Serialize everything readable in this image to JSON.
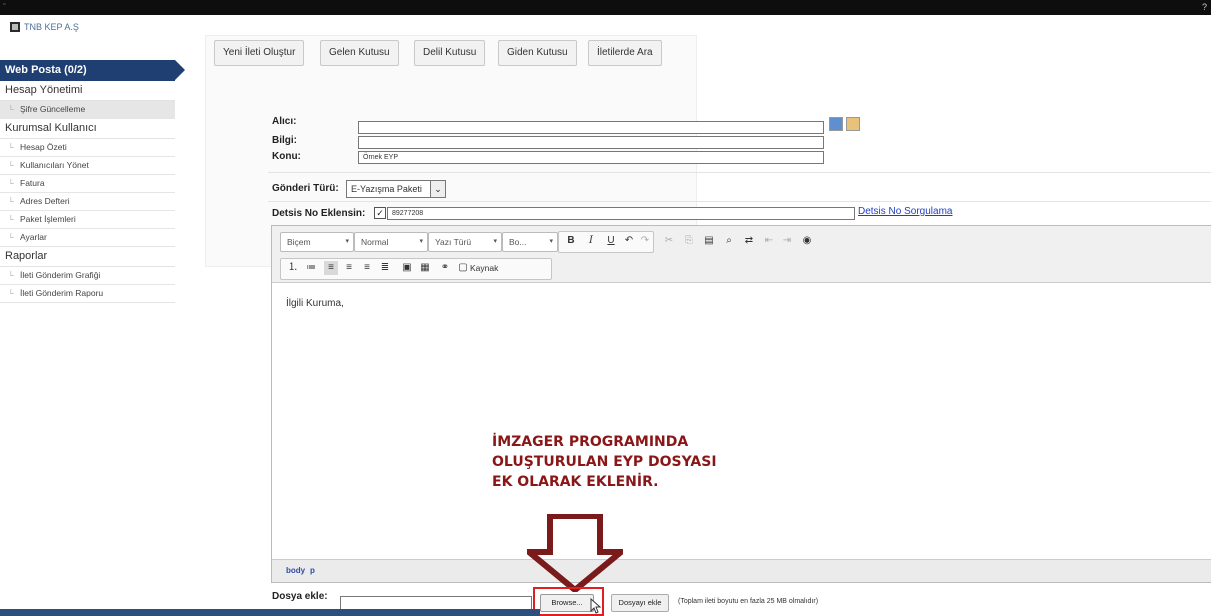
{
  "app": {
    "logo_text": "TNB KEP A.Ş",
    "corner_mark": "?"
  },
  "sidebar": {
    "active_label": "Web Posta (0/2)",
    "sections": [
      {
        "label": "Hesap Yönetimi",
        "items": [
          "Şifre Güncelleme"
        ]
      },
      {
        "label": "Kurumsal Kullanıcı",
        "items": [
          "Hesap Özeti",
          "Kullanıcıları Yönet",
          "Fatura",
          "Adres Defteri",
          "Paket İşlemleri",
          "Ayarlar"
        ]
      },
      {
        "label": "Raporlar",
        "items": [
          "İleti Gönderim Grafiği",
          "İleti Gönderim Raporu"
        ]
      }
    ]
  },
  "toolbar": {
    "buttons": [
      "Yeni İleti Oluştur",
      "Gelen Kutusu",
      "Delil Kutusu",
      "Giden Kutusu",
      "İletilerde Ara"
    ]
  },
  "form": {
    "to_label": "Alıcı:",
    "cc_label": "Bilgi:",
    "subject_label": "Konu:",
    "subject_value": "Örnek EYP",
    "send_type_label": "Gönderi Türü:",
    "send_type_value": "E-Yazışma Paketi",
    "detsis_label": "Detsis No Eklensin:",
    "detsis_value": "89277208",
    "detsis_link": "Detsis No Sorgulama"
  },
  "editor": {
    "format_combo": "Biçem",
    "style_combo": "Normal",
    "font_combo": "Yazı Türü",
    "size_combo": "Bo...",
    "source_label": "Kaynak",
    "body_text": "İlgili Kuruma,",
    "footer_path": [
      "body",
      "p"
    ]
  },
  "attachment": {
    "label": "Dosya ekle:",
    "browse_label": "Browse...",
    "add_label": "Dosyayı ekle",
    "note": "(Toplam ileti boyutu en fazla 25 MB olmalıdır)"
  },
  "annotation": {
    "lines": [
      "İMZAGER PROGRAMINDA",
      "OLUŞTURULAN EYP DOSYASI",
      "EK OLARAK EKLENİR."
    ],
    "color": "#8a1717"
  },
  "colors": {
    "sidebar_active": "#1f3f73",
    "link": "#1f3fbf",
    "highlight_box": "#e02020"
  }
}
